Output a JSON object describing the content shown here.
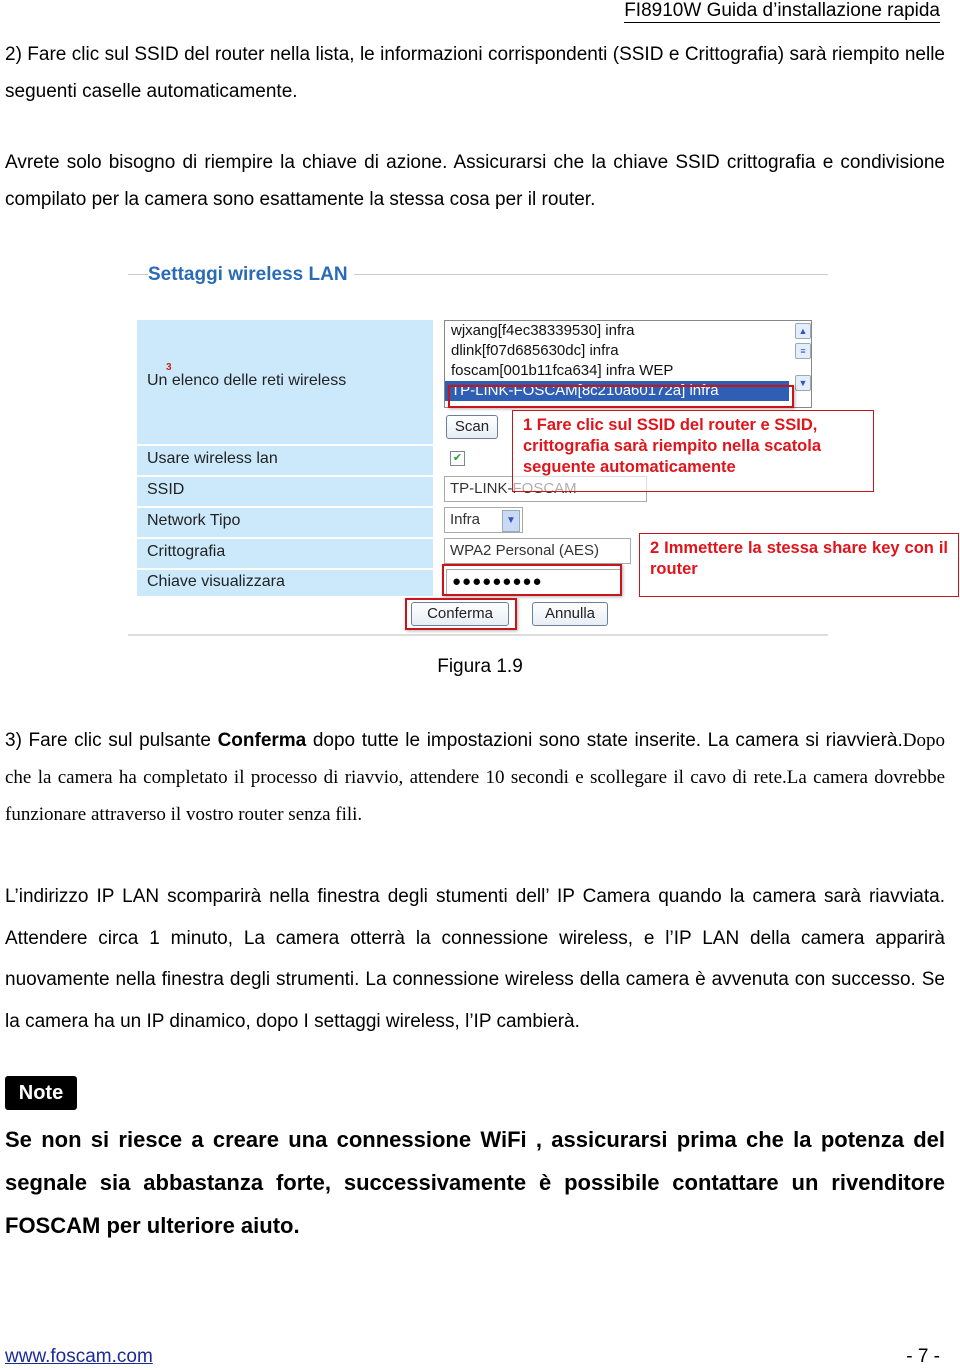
{
  "header": {
    "title": "FI8910W Guida d’installazione rapida"
  },
  "paragraphs": {
    "p1": "2) Fare clic sul SSID del router nella lista, le informazioni corrispondenti (SSID e Crittografia) sarà riempito nelle seguenti caselle automaticamente.",
    "p2": "Avrete solo bisogno di riempire la chiave di azione. Assicurarsi che la chiave SSID crittografia e condivisione compilato per la camera sono esattamente la stessa cosa per il router.",
    "p3_pre": "3) Fare clic sul pulsante ",
    "p3_bold": "Conferma",
    "p3_post": " dopo tutte le impostazioni sono state inserite. La camera si riavvierà.",
    "p3_serif": "Dopo che la camera ha completato il processo di riavvio, attendere 10 secondi e scollegare il cavo di rete.La camera dovrebbe funzionare attraverso il vostro router senza fili.",
    "p4": "L’indirizzo IP LAN scomparirà nella finestra degli stumenti dell’ IP Camera quando la camera sarà riavviata. Attendere circa 1 minuto, La camera otterrà la connessione wireless, e l’IP LAN della camera apparirà nuovamente nella finestra degli strumenti. La connessione wireless della camera è avvenuta con successo. Se la camera ha un IP dinamico, dopo I settaggi wireless, l’IP cambierà."
  },
  "figure": {
    "title": "Settaggi wireless LAN",
    "caption": "Figura 1.9",
    "labels": {
      "network_list": "Un elenco delle reti wireless",
      "marker": "3",
      "use_wireless": "Usare wireless lan",
      "ssid": "SSID",
      "network_type": "Network Tipo",
      "encryption": "Crittografia",
      "key": "Chiave visualizzara"
    },
    "networks": [
      "wjxang[f4ec38339530] infra",
      "dlink[f07d685630dc] infra",
      "foscam[001b11fca634] infra WEP",
      "TP-LINK-FOSCAM[8c210a60172a] infra"
    ],
    "selected_network_index": 3,
    "scan_label": "Scan",
    "use_wireless_checked": true,
    "ssid_value": "TP-LINK-FOSCAM",
    "network_type_value": "Infra",
    "encryption_value": "WPA2 Personal (AES)",
    "key_value": "●●●●●●●●●",
    "confirm_label": "Conferma",
    "cancel_label": "Annulla",
    "callout1": "1 Fare clic sul SSID del router e SSID, crittografia sarà riempito nella scatola seguente automaticamente",
    "callout2": "2 Immettere la stessa share key con il router",
    "accent_color": "#c8151b"
  },
  "note": {
    "badge": "Note",
    "text": "Se non si riesce a creare una connessione WiFi , assicurarsi prima che la potenza del segnale sia abbastanza forte, successivamente è possibile contattare un rivenditore FOSCAM per ulteriore aiuto."
  },
  "footer": {
    "link": "www.foscam.com",
    "page": "- 7 -"
  }
}
